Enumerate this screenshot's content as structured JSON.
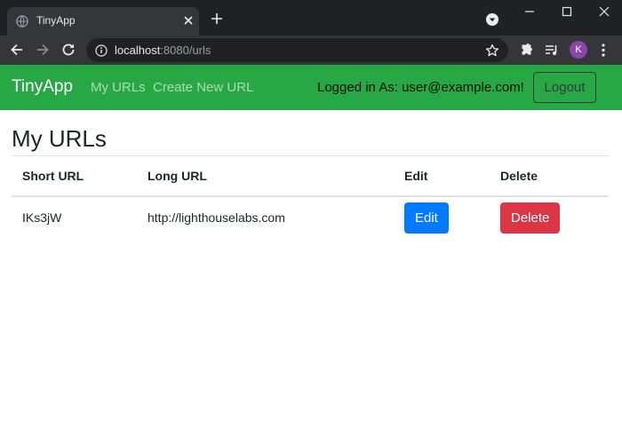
{
  "browser": {
    "tab_title": "TinyApp",
    "url_host": "localhost",
    "url_path": ":8080/urls",
    "profile_initial": "K"
  },
  "navbar": {
    "brand": "TinyApp",
    "links": [
      "My URLs",
      "Create New URL"
    ],
    "logged_in_text": "Logged in As: user@example.com!",
    "logout_label": "Logout"
  },
  "main": {
    "title": "My URLs",
    "table": {
      "headers": [
        "Short URL",
        "Long URL",
        "Edit",
        "Delete"
      ],
      "rows": [
        {
          "short_url": "IKs3jW",
          "long_url": "http://lighthouselabs.com",
          "edit_label": "Edit",
          "delete_label": "Delete"
        }
      ]
    }
  },
  "colors": {
    "navbar": "#28a745",
    "edit_button": "#007bff",
    "delete_button": "#dc3545",
    "browser_dark": "#202124"
  }
}
